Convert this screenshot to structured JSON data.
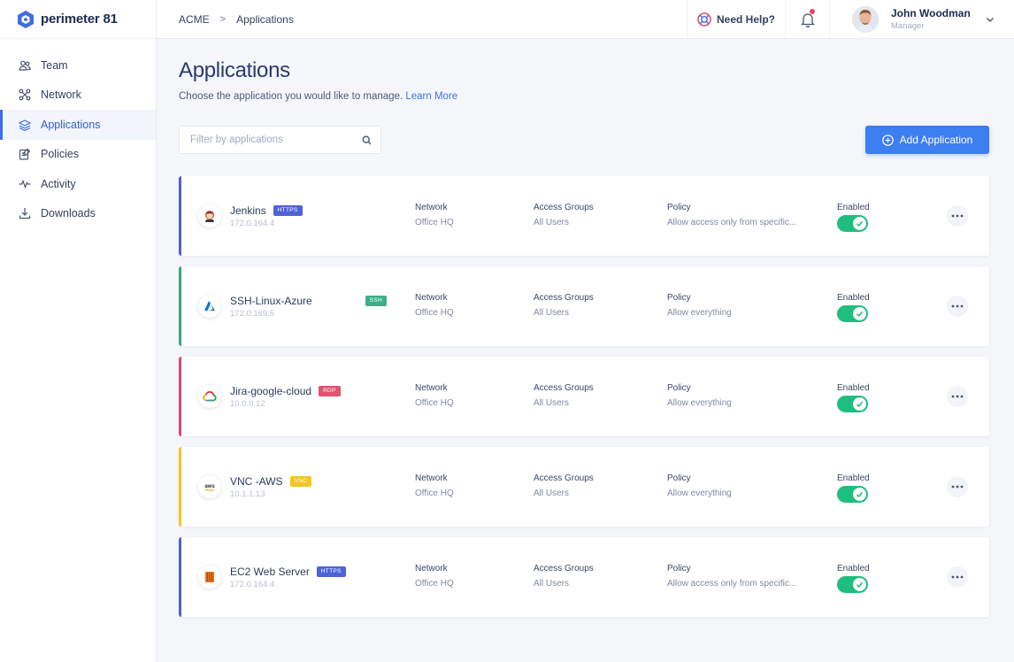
{
  "brand": {
    "name": "perimeter 81"
  },
  "sidebar": {
    "items": [
      {
        "label": "Team",
        "icon": "team-icon",
        "active": false
      },
      {
        "label": "Network",
        "icon": "network-icon",
        "active": false
      },
      {
        "label": "Applications",
        "icon": "applications-icon",
        "active": true
      },
      {
        "label": "Policies",
        "icon": "policies-icon",
        "active": false
      },
      {
        "label": "Activity",
        "icon": "activity-icon",
        "active": false
      },
      {
        "label": "Downloads",
        "icon": "downloads-icon",
        "active": false
      }
    ]
  },
  "topbar": {
    "breadcrumb": [
      "ACME",
      "Applications"
    ],
    "help_label": "Need Help?",
    "user": {
      "name": "John Woodman",
      "role": "Manager"
    }
  },
  "page": {
    "title": "Applications",
    "subtitle": "Choose the application you would like to manage.",
    "learn_more": "Learn More",
    "search_placeholder": "Filter by applications",
    "add_button": "Add Application"
  },
  "columns": {
    "network": "Network",
    "access_groups": "Access Groups",
    "policy": "Policy",
    "enabled": "Enabled"
  },
  "applications": [
    {
      "name": "Jenkins",
      "protocol": "HTTPS",
      "ip": "172.0.164.4",
      "network": "Office HQ",
      "access_groups": "All Users",
      "policy": "Allow access only from specific...",
      "enabled": true,
      "accent": "#4a63c9",
      "badge_color": "#4d63d6",
      "icon": "jenkins-icon"
    },
    {
      "name": "SSH-Linux-Azure",
      "protocol": "SSH",
      "ip": "172.0.169.5",
      "network": "Office HQ",
      "access_groups": "All Users",
      "policy": "Allow everything",
      "enabled": true,
      "accent": "#39a77f",
      "badge_color": "#3ab087",
      "icon": "azure-icon"
    },
    {
      "name": "Jira-google-cloud",
      "protocol": "RDP",
      "ip": "10.0.0.12",
      "network": "Office HQ",
      "access_groups": "All Users",
      "policy": "Allow everything",
      "enabled": true,
      "accent": "#d4466d",
      "badge_color": "#e0526f",
      "icon": "google-cloud-icon"
    },
    {
      "name": "VNC -AWS",
      "protocol": "VNC",
      "ip": "10.1.1.13",
      "network": "Office HQ",
      "access_groups": "All Users",
      "policy": "Allow everything",
      "enabled": true,
      "accent": "#f2c528",
      "badge_color": "#f2c528",
      "icon": "aws-icon"
    },
    {
      "name": "EC2 Web Server",
      "protocol": "HTTPS",
      "ip": "172.0.164.4",
      "network": "Office HQ",
      "access_groups": "All Users",
      "policy": "Allow access only from specific...",
      "enabled": true,
      "accent": "#4a63c9",
      "badge_color": "#4d63d6",
      "icon": "ec2-icon"
    }
  ],
  "colors": {
    "accent": "#3d7ef0",
    "toggle_on": "#1fbe7e",
    "active_nav": "#2f5fd0"
  }
}
